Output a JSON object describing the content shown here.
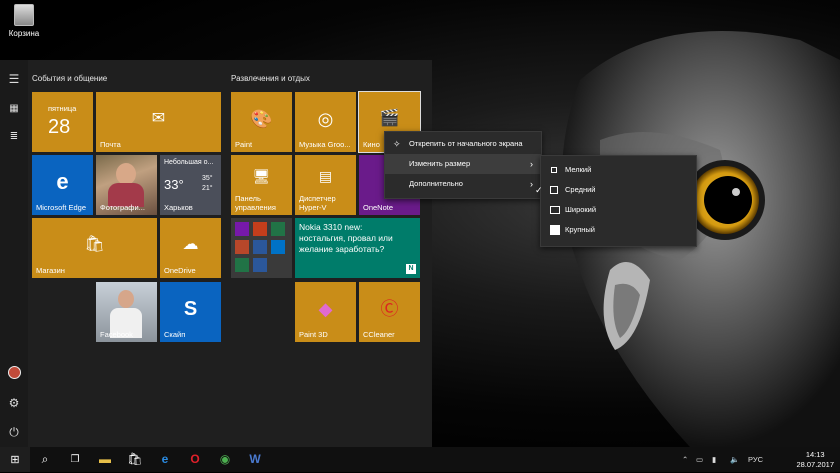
{
  "desktop": {
    "recycle_bin_label": "Корзина"
  },
  "start": {
    "group1_title": "События и общение",
    "group2_title": "Развлечения и отдых",
    "calendar": {
      "day_name": "пятница",
      "day_number": "28"
    },
    "tiles": {
      "mail": "Почта",
      "edge": "Microsoft Edge",
      "photos": "Фотографи...",
      "weather": {
        "condition": "Небольшая о...",
        "temp": "33°",
        "high": "35°",
        "low": "21°",
        "city": "Харьков"
      },
      "store": "Магазин",
      "onedrive": "OneDrive",
      "facebook": "Facebook",
      "skype": "Скайп",
      "paint": "Paint",
      "groove": "Музыка Groo...",
      "movies": "Кино",
      "control_panel": "Панель управления",
      "hyperv": "Диспетчер Hyper-V",
      "onenote": "OneNote",
      "news": "Nokia 3310 new: ностальгия, провал или желание заработать?",
      "paint3d": "Paint 3D",
      "ccleaner": "CCleaner"
    }
  },
  "context_menu": {
    "unpin": "Открепить от начального экрана",
    "resize": "Изменить размер",
    "more": "Дополнительно"
  },
  "size_menu": {
    "small": "Мелкий",
    "medium": "Средний",
    "wide": "Широкий",
    "large": "Крупный"
  },
  "taskbar": {
    "language": "РУС",
    "time": "14:13",
    "date": "28.07.2017"
  }
}
